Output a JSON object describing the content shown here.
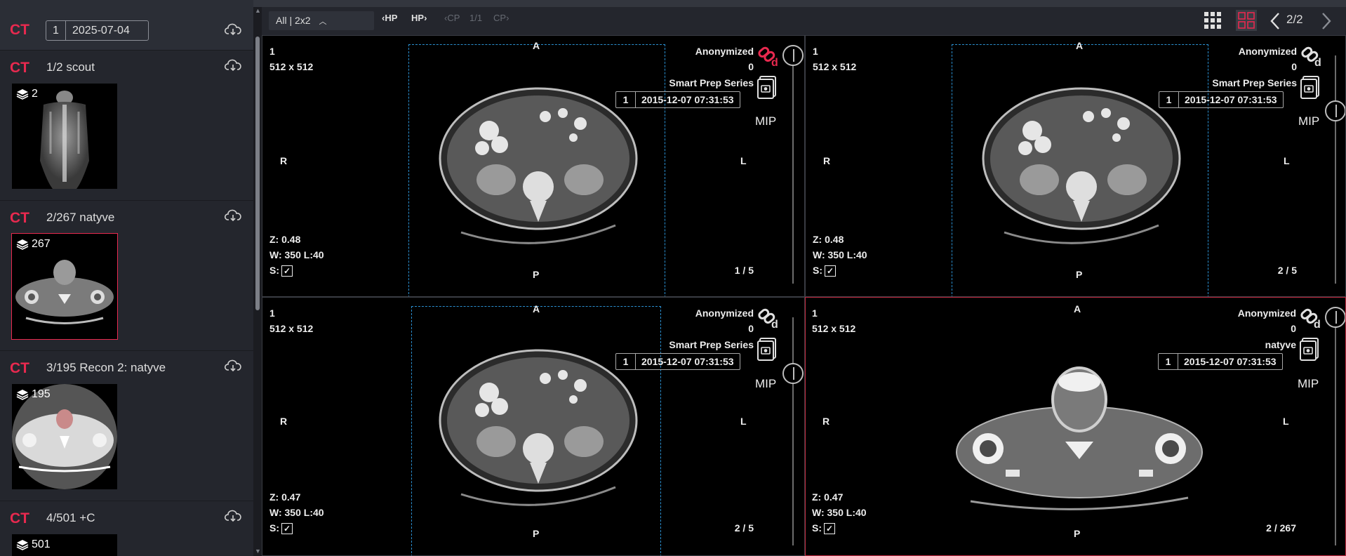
{
  "study": {
    "modality": "CT",
    "number": "1",
    "date": "2025-07-04"
  },
  "series": [
    {
      "modality": "CT",
      "title": "1/2 scout",
      "count": "2"
    },
    {
      "modality": "CT",
      "title": "2/267 natyve",
      "count": "267"
    },
    {
      "modality": "CT",
      "title": "3/195 Recon 2: natyve",
      "count": "195"
    },
    {
      "modality": "CT",
      "title": "4/501 +C",
      "count": "501"
    }
  ],
  "toolbar": {
    "layout_label": "All | 2x2",
    "hp_prev": "HP",
    "hp_next": "HP",
    "cp_prev": "CP",
    "cp_pos": "1/1",
    "cp_next": "CP",
    "page": "2/2"
  },
  "viewports": [
    {
      "series": "1",
      "matrix": "512 x 512",
      "anon": "Anonymized",
      "zero": "0",
      "desc": "Smart Prep Series",
      "idx": "1",
      "datetime": "2015-12-07 07:31:53",
      "mip": "MIP",
      "zoom": "Z: 0.48",
      "wl": "W: 350 L:40",
      "s": "S:",
      "frame": "1 / 5",
      "top": "A",
      "bottom": "P",
      "left": "R",
      "right": "L"
    },
    {
      "series": "1",
      "matrix": "512 x 512",
      "anon": "Anonymized",
      "zero": "0",
      "desc": "Smart Prep Series",
      "idx": "1",
      "datetime": "2015-12-07 07:31:53",
      "mip": "MIP",
      "zoom": "Z: 0.48",
      "wl": "W: 350 L:40",
      "s": "S:",
      "frame": "2 / 5",
      "top": "A",
      "bottom": "P",
      "left": "R",
      "right": "L"
    },
    {
      "series": "1",
      "matrix": "512 x 512",
      "anon": "Anonymized",
      "zero": "0",
      "desc": "Smart Prep Series",
      "idx": "1",
      "datetime": "2015-12-07 07:31:53",
      "mip": "MIP",
      "zoom": "Z: 0.47",
      "wl": "W: 350 L:40",
      "s": "S:",
      "frame": "2 / 5",
      "top": "A",
      "bottom": "P",
      "left": "R",
      "right": "L"
    },
    {
      "series": "1",
      "matrix": "512 x 512",
      "anon": "Anonymized",
      "zero": "0",
      "desc": "natyve",
      "idx": "1",
      "datetime": "2015-12-07 07:31:53",
      "mip": "MIP",
      "zoom": "Z: 0.47",
      "wl": "W: 350 L:40",
      "s": "S:",
      "frame": "2 / 267",
      "top": "A",
      "bottom": "P",
      "left": "R",
      "right": "L"
    }
  ],
  "colors": {
    "accent": "#e8294f",
    "sidebar": "#24262d",
    "crosshair": "#2a8fd0"
  },
  "icons": [
    "download-icon",
    "layers-icon",
    "link-icon",
    "snapshot-icon",
    "grid-icon",
    "layout-icon",
    "chevron-left-icon",
    "chevron-right-icon"
  ]
}
